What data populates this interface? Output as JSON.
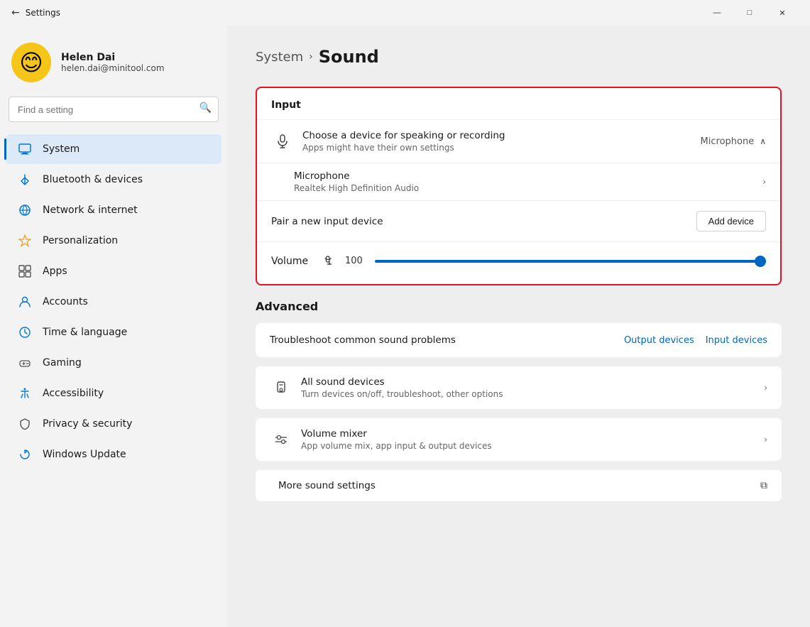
{
  "titlebar": {
    "title": "Settings",
    "minimize": "—",
    "maximize": "□",
    "close": "✕"
  },
  "user": {
    "name": "Helen Dai",
    "email": "helen.dai@minitool.com",
    "avatar_emoji": "😊"
  },
  "search": {
    "placeholder": "Find a setting"
  },
  "nav": {
    "items": [
      {
        "id": "system",
        "label": "System",
        "icon_class": "system",
        "active": true
      },
      {
        "id": "bluetooth",
        "label": "Bluetooth & devices",
        "icon_class": "bluetooth",
        "active": false
      },
      {
        "id": "network",
        "label": "Network & internet",
        "icon_class": "network",
        "active": false
      },
      {
        "id": "personalization",
        "label": "Personalization",
        "icon_class": "personalization",
        "active": false
      },
      {
        "id": "apps",
        "label": "Apps",
        "icon_class": "apps",
        "active": false
      },
      {
        "id": "accounts",
        "label": "Accounts",
        "icon_class": "accounts",
        "active": false
      },
      {
        "id": "time",
        "label": "Time & language",
        "icon_class": "time",
        "active": false
      },
      {
        "id": "gaming",
        "label": "Gaming",
        "icon_class": "gaming",
        "active": false
      },
      {
        "id": "accessibility",
        "label": "Accessibility",
        "icon_class": "accessibility",
        "active": false
      },
      {
        "id": "privacy",
        "label": "Privacy & security",
        "icon_class": "privacy",
        "active": false
      },
      {
        "id": "windows-update",
        "label": "Windows Update",
        "icon_class": "windows-update",
        "active": false
      }
    ]
  },
  "breadcrumb": {
    "system": "System",
    "arrow": "›",
    "current": "Sound"
  },
  "input_section": {
    "header": "Input",
    "choose_device_title": "Choose a device for speaking or recording",
    "choose_device_subtitle": "Apps might have their own settings",
    "microphone_label": "Microphone",
    "expand_icon": "∧",
    "mic_item_title": "Microphone",
    "mic_item_subtitle": "Realtek High Definition Audio",
    "pair_title": "Pair a new input device",
    "add_device_btn": "Add device",
    "volume_label": "Volume",
    "volume_value": "100"
  },
  "advanced_section": {
    "header": "Advanced",
    "troubleshoot_label": "Troubleshoot common sound problems",
    "output_devices_link": "Output devices",
    "input_devices_link": "Input devices",
    "all_sound_devices_title": "All sound devices",
    "all_sound_devices_subtitle": "Turn devices on/off, troubleshoot, other options",
    "volume_mixer_title": "Volume mixer",
    "volume_mixer_subtitle": "App volume mix, app input & output devices",
    "more_sound_settings_title": "More sound settings"
  }
}
